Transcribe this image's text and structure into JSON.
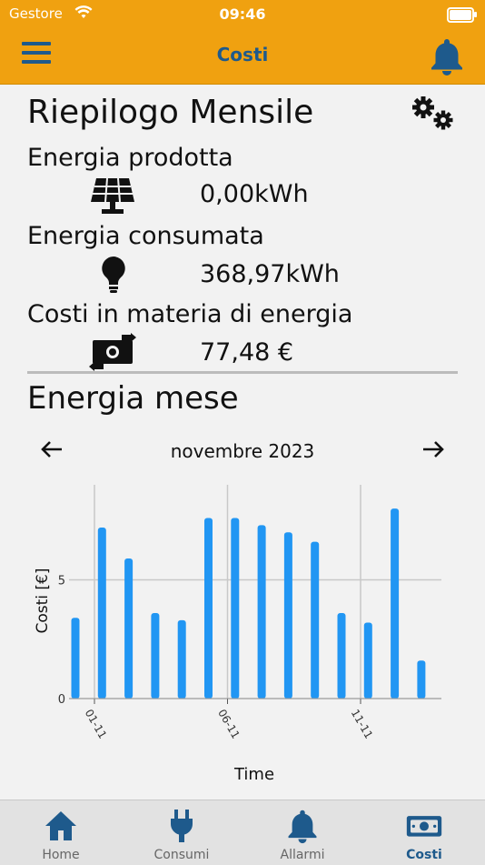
{
  "status": {
    "carrier": "Gestore",
    "time": "09:46"
  },
  "nav": {
    "title": "Costi"
  },
  "summary": {
    "title": "Riepilogo Mensile",
    "produced_label": "Energia prodotta",
    "produced_value": "0,00kWh",
    "consumed_label": "Energia consumata",
    "consumed_value": "368,97kWh",
    "cost_label": "Costi in materia di energia",
    "cost_value": "77,48 €"
  },
  "energy": {
    "title": "Energia mese",
    "month": "novembre 2023",
    "prev_icon": "arrow-left",
    "next_icon": "arrow-right"
  },
  "chart_data": {
    "type": "bar",
    "categories": [
      "01-11",
      "02-11",
      "03-11",
      "04-11",
      "05-11",
      "06-11",
      "07-11",
      "08-11",
      "09-11",
      "10-11",
      "11-11",
      "12-11",
      "13-11",
      "14-11"
    ],
    "values": [
      3.4,
      7.2,
      5.9,
      3.6,
      3.3,
      7.6,
      7.6,
      7.3,
      7.0,
      6.6,
      3.6,
      3.2,
      8.0,
      1.6
    ],
    "xtick_labels": [
      "01-11",
      "06-11",
      "11-11"
    ],
    "yticks": [
      "0",
      "5"
    ],
    "ylabel": "Costi [€]",
    "xlabel": "Time",
    "ylim": [
      0,
      9
    ],
    "color": "#2196f3",
    "grid": true
  },
  "tabs": [
    {
      "label": "Home",
      "icon": "home-icon"
    },
    {
      "label": "Consumi",
      "icon": "plug-icon"
    },
    {
      "label": "Allarmi",
      "icon": "bell-icon"
    },
    {
      "label": "Costi",
      "icon": "money-icon"
    }
  ],
  "colors": {
    "accent": "#f0a110",
    "primary": "#1e5a8c",
    "bar": "#2196f3"
  }
}
